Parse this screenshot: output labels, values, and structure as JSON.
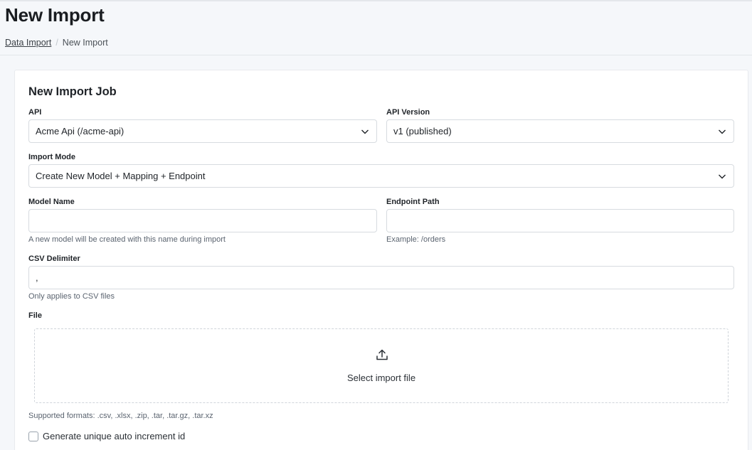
{
  "page": {
    "title": "New Import",
    "breadcrumb": {
      "parent": "Data Import",
      "separator": "/",
      "current": "New Import"
    }
  },
  "form": {
    "title": "New Import Job",
    "api": {
      "label": "API",
      "value": "Acme Api (/acme-api)",
      "icon": "chevron-down-icon"
    },
    "api_version": {
      "label": "API Version",
      "value": "v1 (published)",
      "icon": "chevron-down-icon"
    },
    "import_mode": {
      "label": "Import Mode",
      "value": "Create New Model + Mapping + Endpoint",
      "icon": "chevron-down-icon"
    },
    "model_name": {
      "label": "Model Name",
      "value": "",
      "hint": "A new model will be created with this name during import"
    },
    "endpoint_path": {
      "label": "Endpoint Path",
      "value": "",
      "hint": "Example: /orders"
    },
    "csv_delimiter": {
      "label": "CSV Delimiter",
      "value": ",",
      "hint": "Only applies to CSV files"
    },
    "file": {
      "label": "File",
      "dropzone_text": "Select import file",
      "icon": "upload-icon",
      "hint": "Supported formats: .csv, .xlsx, .zip, .tar, .tar.gz, .tar.xz"
    },
    "auto_increment": {
      "label": "Generate unique auto increment id",
      "checked": false
    }
  },
  "colors": {
    "background": "#f5f7fa",
    "card": "#ffffff",
    "border": "#d7dbe0",
    "hint": "#5b6470"
  }
}
